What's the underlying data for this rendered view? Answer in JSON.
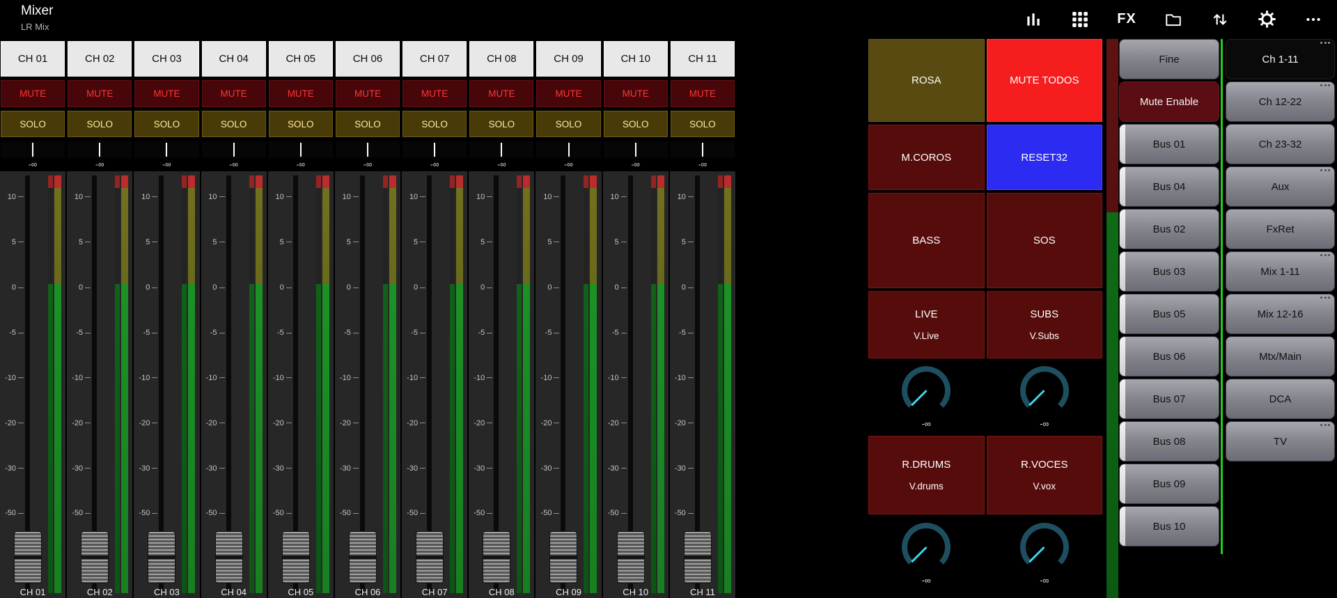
{
  "header": {
    "title": "Mixer",
    "subtitle": "LR Mix",
    "fx_label": "FX",
    "icons": [
      "levels-view-icon",
      "channel-grid-icon",
      "fx-button",
      "folder-icon",
      "io-routing-icon",
      "settings-gear-icon",
      "more-menu-icon"
    ]
  },
  "channels": [
    {
      "label": "CH 01",
      "mute": "MUTE",
      "solo": "SOLO",
      "fader_value": "-∞"
    },
    {
      "label": "CH 02",
      "mute": "MUTE",
      "solo": "SOLO",
      "fader_value": "-∞"
    },
    {
      "label": "CH 03",
      "mute": "MUTE",
      "solo": "SOLO",
      "fader_value": "-∞"
    },
    {
      "label": "CH 04",
      "mute": "MUTE",
      "solo": "SOLO",
      "fader_value": "-∞"
    },
    {
      "label": "CH 05",
      "mute": "MUTE",
      "solo": "SOLO",
      "fader_value": "-∞"
    },
    {
      "label": "CH 06",
      "mute": "MUTE",
      "solo": "SOLO",
      "fader_value": "-∞"
    },
    {
      "label": "CH 07",
      "mute": "MUTE",
      "solo": "SOLO",
      "fader_value": "-∞"
    },
    {
      "label": "CH 08",
      "mute": "MUTE",
      "solo": "SOLO",
      "fader_value": "-∞"
    },
    {
      "label": "CH 09",
      "mute": "MUTE",
      "solo": "SOLO",
      "fader_value": "-∞"
    },
    {
      "label": "CH 10",
      "mute": "MUTE",
      "solo": "SOLO",
      "fader_value": "-∞"
    },
    {
      "label": "CH 11",
      "mute": "MUTE",
      "solo": "SOLO",
      "fader_value": "-∞"
    }
  ],
  "fader_scale": [
    "10",
    "5",
    "0",
    "-5",
    "-10",
    "-20",
    "-30",
    "-50"
  ],
  "center": {
    "rows": [
      {
        "type": "buttons",
        "items": [
          {
            "label": "ROSA",
            "style": "olive"
          },
          {
            "label": "MUTE TODOS",
            "style": "bright-red"
          }
        ]
      },
      {
        "type": "buttons",
        "items": [
          {
            "label": "M.COROS",
            "style": "dark-red"
          },
          {
            "label": "RESET32",
            "style": "blue"
          }
        ]
      },
      {
        "type": "buttons",
        "items": [
          {
            "label": "BASS",
            "style": "dark-red"
          },
          {
            "label": "SOS",
            "style": "dark-red"
          }
        ]
      },
      {
        "type": "buttons",
        "items": [
          {
            "label": "LIVE",
            "sub": "V.Live",
            "style": "dark-red"
          },
          {
            "label": "SUBS",
            "sub": "V.Subs",
            "style": "dark-red"
          }
        ]
      },
      {
        "type": "knobs",
        "items": [
          {
            "value": "-∞"
          },
          {
            "value": "-∞"
          }
        ]
      },
      {
        "type": "buttons",
        "items": [
          {
            "label": "R.DRUMS",
            "sub": "V.drums",
            "style": "dark-red"
          },
          {
            "label": "R.VOCES",
            "sub": "V.vox",
            "style": "dark-red"
          }
        ]
      },
      {
        "type": "knobs",
        "items": [
          {
            "value": "-∞"
          },
          {
            "value": "-∞"
          }
        ]
      }
    ]
  },
  "right_panel": {
    "left_column": [
      {
        "label": "Fine",
        "style": "gray"
      },
      {
        "label": "Mute Enable",
        "style": "dark-red"
      },
      {
        "label": "Bus 01",
        "style": "gray",
        "stripe": true
      },
      {
        "label": "Bus 04",
        "style": "gray",
        "stripe": true
      },
      {
        "label": "Bus 02",
        "style": "gray",
        "stripe": true
      },
      {
        "label": "Bus 03",
        "style": "gray",
        "stripe": true
      },
      {
        "label": "Bus 05",
        "style": "gray",
        "stripe": true
      },
      {
        "label": "Bus 06",
        "style": "gray",
        "stripe": true
      },
      {
        "label": "Bus 07",
        "style": "gray",
        "stripe": true
      },
      {
        "label": "Bus 08",
        "style": "gray",
        "stripe": true
      },
      {
        "label": "Bus 09",
        "style": "gray",
        "stripe": true
      },
      {
        "label": "Bus 10",
        "style": "gray",
        "stripe": true
      }
    ],
    "right_column": [
      {
        "label": "Ch 1-11",
        "selected": true,
        "dots": true
      },
      {
        "label": "Ch 12-22",
        "dots": true
      },
      {
        "label": "Ch 23-32"
      },
      {
        "label": "Aux",
        "dots": true
      },
      {
        "label": "FxRet"
      },
      {
        "label": "Mix 1-11",
        "dots": true
      },
      {
        "label": "Mix 12-16",
        "dots": true
      },
      {
        "label": "Mtx/Main"
      },
      {
        "label": "DCA"
      },
      {
        "label": "TV",
        "dots": true
      }
    ]
  },
  "colors": {
    "accent_green": "#22cd22",
    "mute_text": "#ff3636",
    "solo_text": "#ffeca2",
    "bright_red": "#f51d1d",
    "blue": "#2b2bf2",
    "dark_red": "#570c0c",
    "olive": "#584a11",
    "knob_pointer": "#3bd9ed",
    "meter_green": "#1c9226"
  }
}
